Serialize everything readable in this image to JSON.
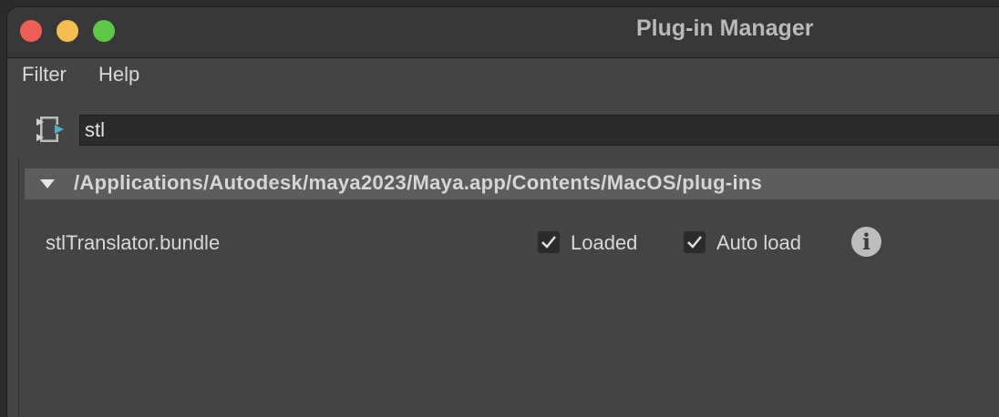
{
  "window": {
    "title": "Plug-in Manager",
    "controls": [
      "close",
      "minimize",
      "zoom"
    ]
  },
  "menu": {
    "filter_label": "Filter",
    "help_label": "Help"
  },
  "search": {
    "value": "stl",
    "icon": "filter-icon"
  },
  "group": {
    "path": "/Applications/Autodesk/maya2023/Maya.app/Contents/MacOS/plug-ins",
    "expanded": true
  },
  "plugins": [
    {
      "name": "stlTranslator.bundle",
      "loaded_label": "Loaded",
      "loaded": true,
      "autoload_label": "Auto load",
      "autoload": true,
      "info_glyph": "i"
    }
  ],
  "colors": {
    "background": "#444444",
    "titlebar": "#383838",
    "group_header": "#5d5d5d",
    "field": "#2b2b2b",
    "close": "#ee5f58",
    "minimize": "#f5bd4f",
    "zoom": "#5ec747"
  }
}
